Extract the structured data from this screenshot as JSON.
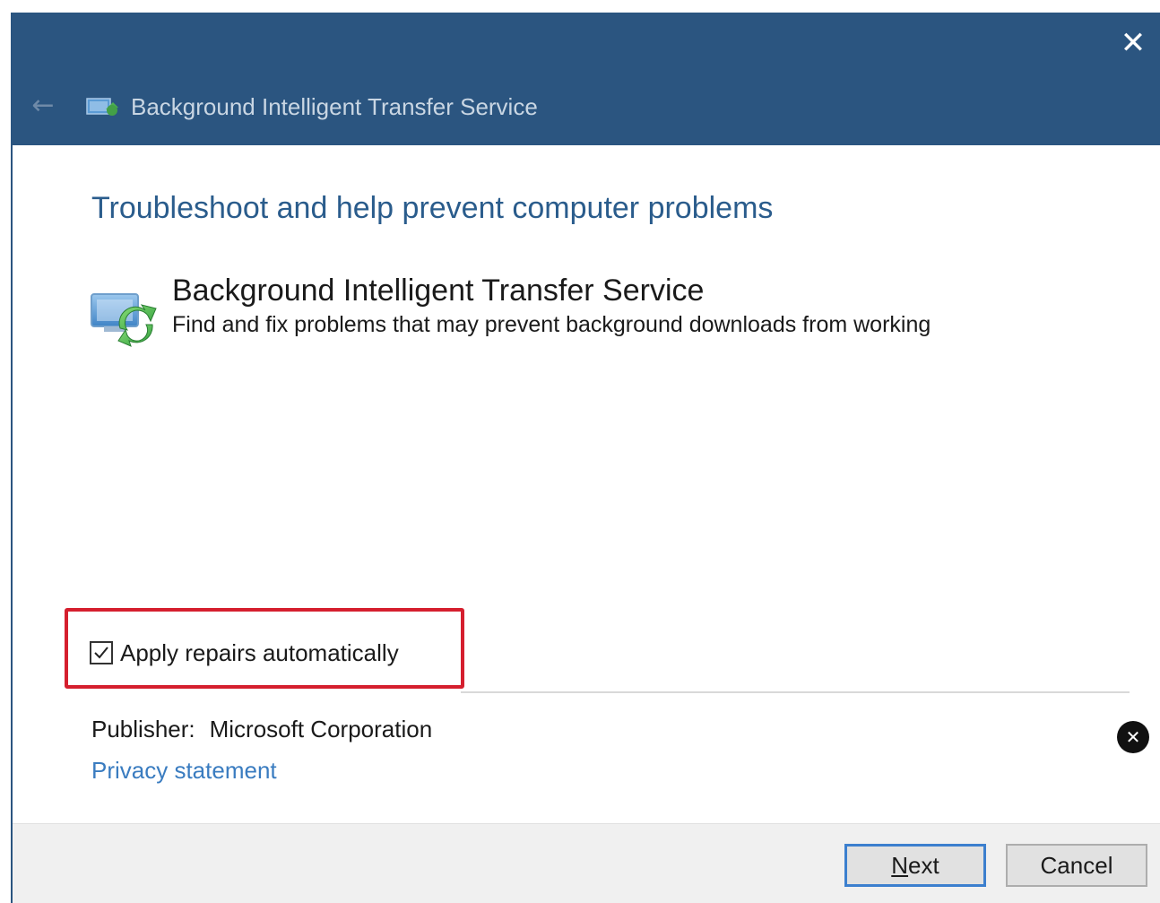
{
  "window": {
    "title": "Background Intelligent Transfer Service",
    "close_glyph": "✕",
    "back_glyph": "←"
  },
  "main": {
    "heading": "Troubleshoot and help prevent computer problems",
    "service": {
      "name": "Background Intelligent Transfer Service",
      "description": "Find and fix problems that may prevent background downloads from working",
      "icon": "bits-transfer-icon"
    },
    "apply_repairs": {
      "label": "Apply repairs automatically",
      "checked": true
    },
    "publisher": {
      "label": "Publisher:",
      "value": "Microsoft Corporation"
    },
    "privacy_link": "Privacy statement"
  },
  "overlay": {
    "dismiss_glyph": "✕"
  },
  "footer": {
    "next_mnemonic": "N",
    "next_rest": "ext",
    "cancel_label": "Cancel"
  },
  "colors": {
    "titlebar": "#2b5580",
    "heading": "#2a5c8c",
    "link": "#3a7cc0",
    "highlight_border": "#d51f2e",
    "default_button_border": "#3c7fce"
  }
}
